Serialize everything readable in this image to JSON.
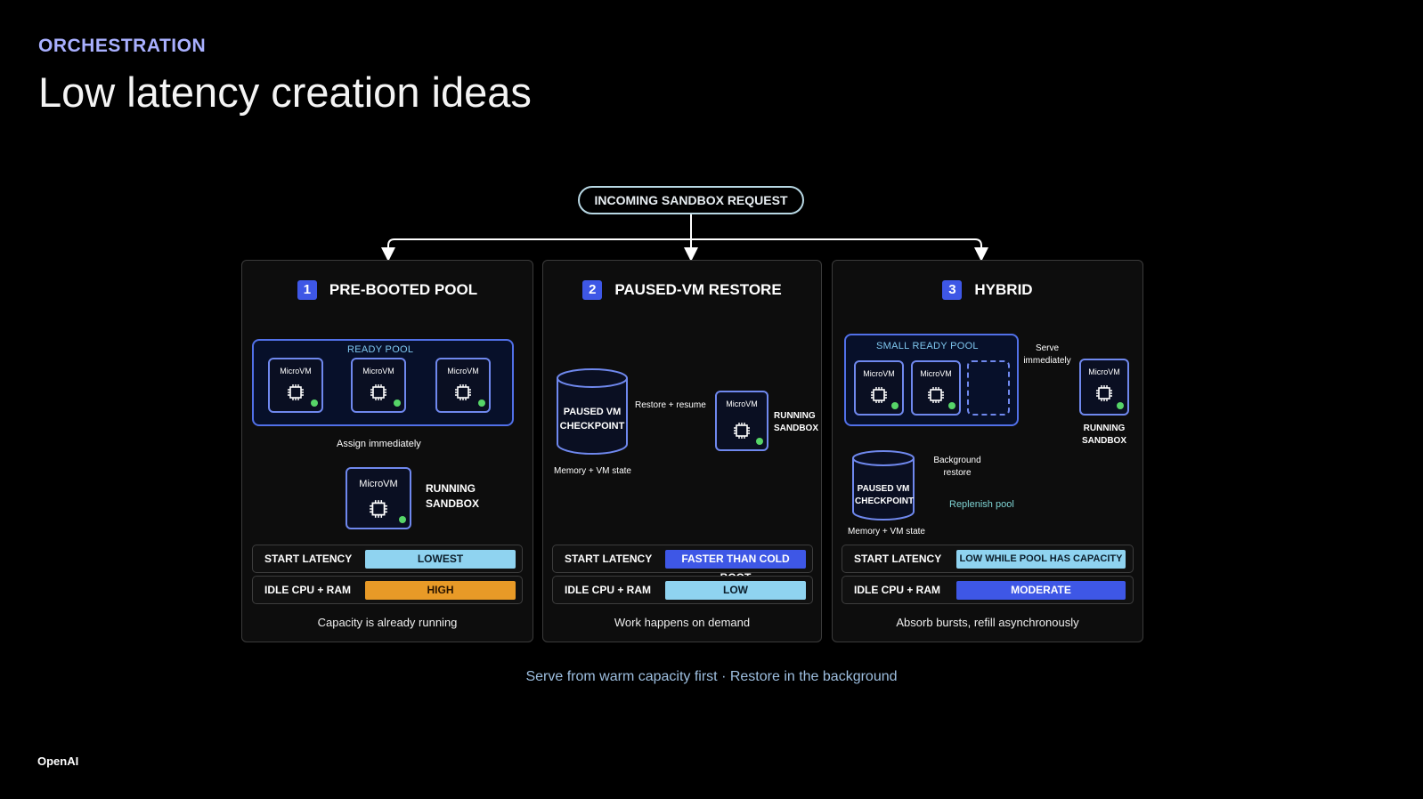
{
  "header": {
    "eyebrow": "ORCHESTRATION",
    "title": "Low latency creation ideas"
  },
  "request": {
    "label": "INCOMING SANDBOX REQUEST"
  },
  "panels": [
    {
      "number": "1",
      "title": "PRE-BOOTED POOL",
      "pool_label": "READY POOL",
      "vm_label": "MicroVM",
      "assign_label": "Assign immediately",
      "running_label": "RUNNING SANDBOX",
      "metrics": [
        {
          "name": "START LATENCY",
          "value": "LOWEST",
          "color": "#8fd3f0",
          "text_color": "#0b1d2a"
        },
        {
          "name": "IDLE CPU + RAM",
          "value": "HIGH",
          "color": "#e89a27",
          "text_color": "#2a1500"
        }
      ],
      "caption": "Capacity is already running"
    },
    {
      "number": "2",
      "title": "PAUSED-VM RESTORE",
      "checkpoint_label": "PAUSED VM CHECKPOINT",
      "memory_label": "Memory + VM state",
      "restore_label": "Restore + resume",
      "vm_label": "MicroVM",
      "running_label": "RUNNING SANDBOX",
      "metrics": [
        {
          "name": "START LATENCY",
          "value": "FASTER THAN COLD BOOT",
          "color": "#3e57e6",
          "text_color": "#ffffff"
        },
        {
          "name": "IDLE CPU + RAM",
          "value": "LOW",
          "color": "#8fd3f0",
          "text_color": "#0b1d2a"
        }
      ],
      "caption": "Work happens on demand"
    },
    {
      "number": "3",
      "title": "HYBRID",
      "pool_label": "SMALL READY POOL",
      "vm_label": "MicroVM",
      "serve_label": "Serve immediately",
      "running_label": "RUNNING SANDBOX",
      "checkpoint_label": "PAUSED VM CHECKPOINT",
      "memory_label": "Memory + VM state",
      "background_label": "Background restore",
      "replenish_label": "Replenish pool",
      "metrics": [
        {
          "name": "START LATENCY",
          "value": "LOW WHILE POOL HAS CAPACITY",
          "color": "#8fd3f0",
          "text_color": "#0b1d2a"
        },
        {
          "name": "IDLE CPU + RAM",
          "value": "MODERATE",
          "color": "#3e57e6",
          "text_color": "#ffffff"
        }
      ],
      "caption": "Absorb bursts, refill asynchronously"
    }
  ],
  "footer": {
    "note": "Serve from warm capacity first · Restore in the background",
    "brand": "OpenAI"
  },
  "icons": [
    "chip-icon",
    "status-dot-icon",
    "database-icon",
    "arrow-icon"
  ]
}
